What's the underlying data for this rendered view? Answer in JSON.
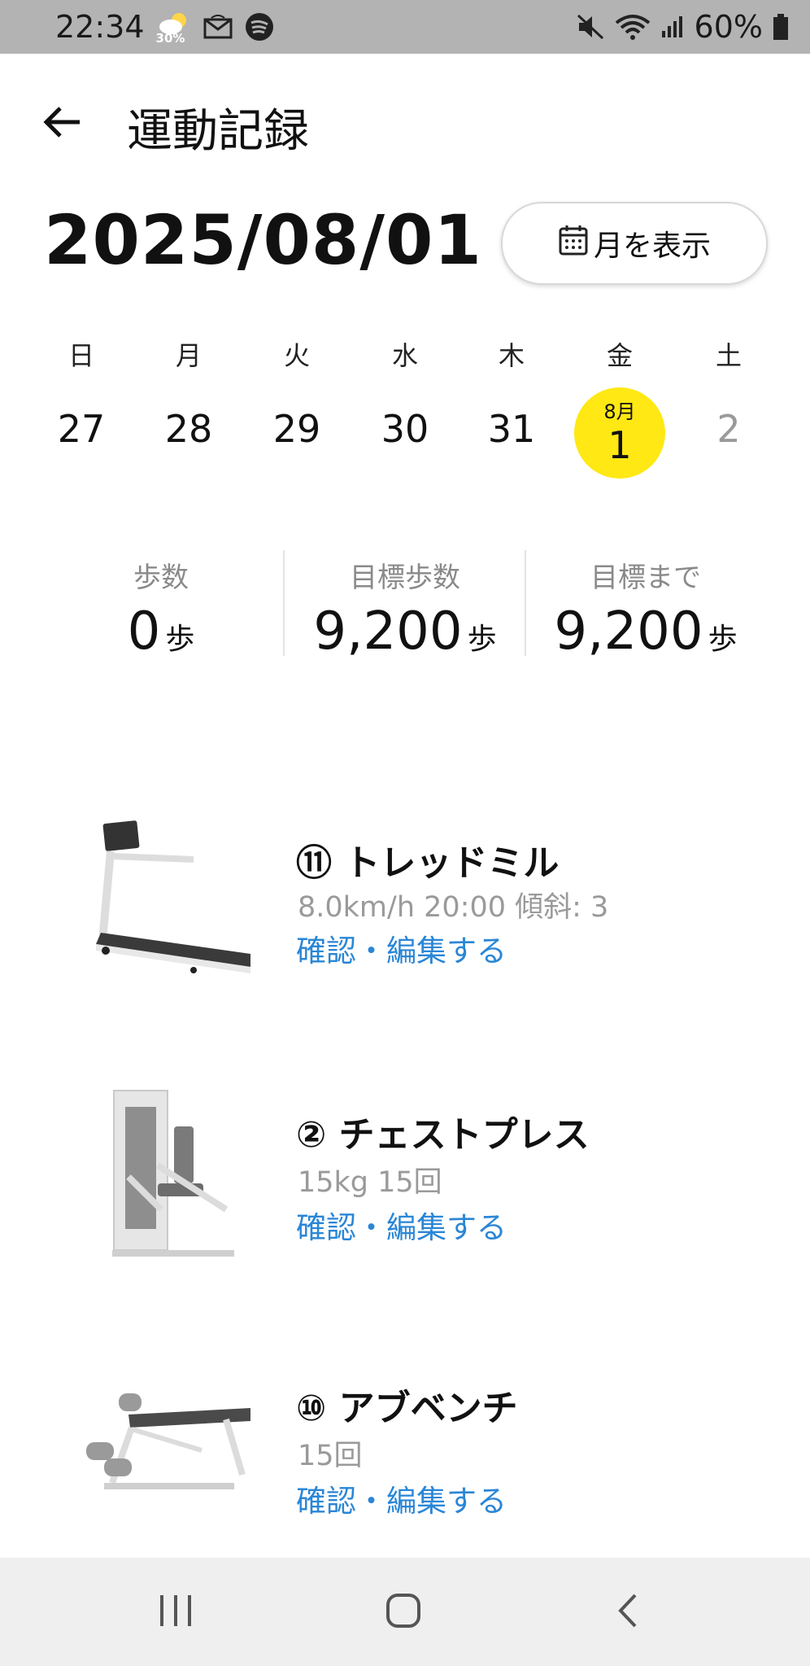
{
  "status_bar": {
    "time": "22:34",
    "weather_pct": "30%",
    "battery": "60%",
    "icons": [
      "weather-icon",
      "mail-icon",
      "spotify-icon",
      "mute-icon",
      "wifi-icon",
      "signal-icon",
      "battery-icon"
    ]
  },
  "header": {
    "title": "運動記録"
  },
  "date_title": "2025/08/01",
  "month_button": {
    "label": "月を表示"
  },
  "week": {
    "weekdays": [
      "日",
      "月",
      "火",
      "水",
      "木",
      "金",
      "土"
    ],
    "days": [
      "27",
      "28",
      "29",
      "30",
      "31",
      "1",
      "2"
    ],
    "selected_month": "8月",
    "selected_day": "1",
    "selected_color": "#ffe814"
  },
  "stats": [
    {
      "label": "歩数",
      "value": "0",
      "unit": "歩"
    },
    {
      "label": "目標歩数",
      "value": "9,200",
      "unit": "歩"
    },
    {
      "label": "目標まで",
      "value": "9,200",
      "unit": "歩"
    }
  ],
  "exercises": [
    {
      "title": "⑪ トレッドミル",
      "detail": "8.0km/h 20:00 傾斜: 3",
      "link": "確認・編集する",
      "image": "treadmill"
    },
    {
      "title": "② チェストプレス",
      "detail": "15kg 15回",
      "link": "確認・編集する",
      "image": "chest-press-machine"
    },
    {
      "title": "⑩ アブベンチ",
      "detail": "15回",
      "link": "確認・編集する",
      "image": "ab-bench"
    }
  ],
  "colors": {
    "link": "#2a86d6",
    "accent": "#ffe814"
  }
}
